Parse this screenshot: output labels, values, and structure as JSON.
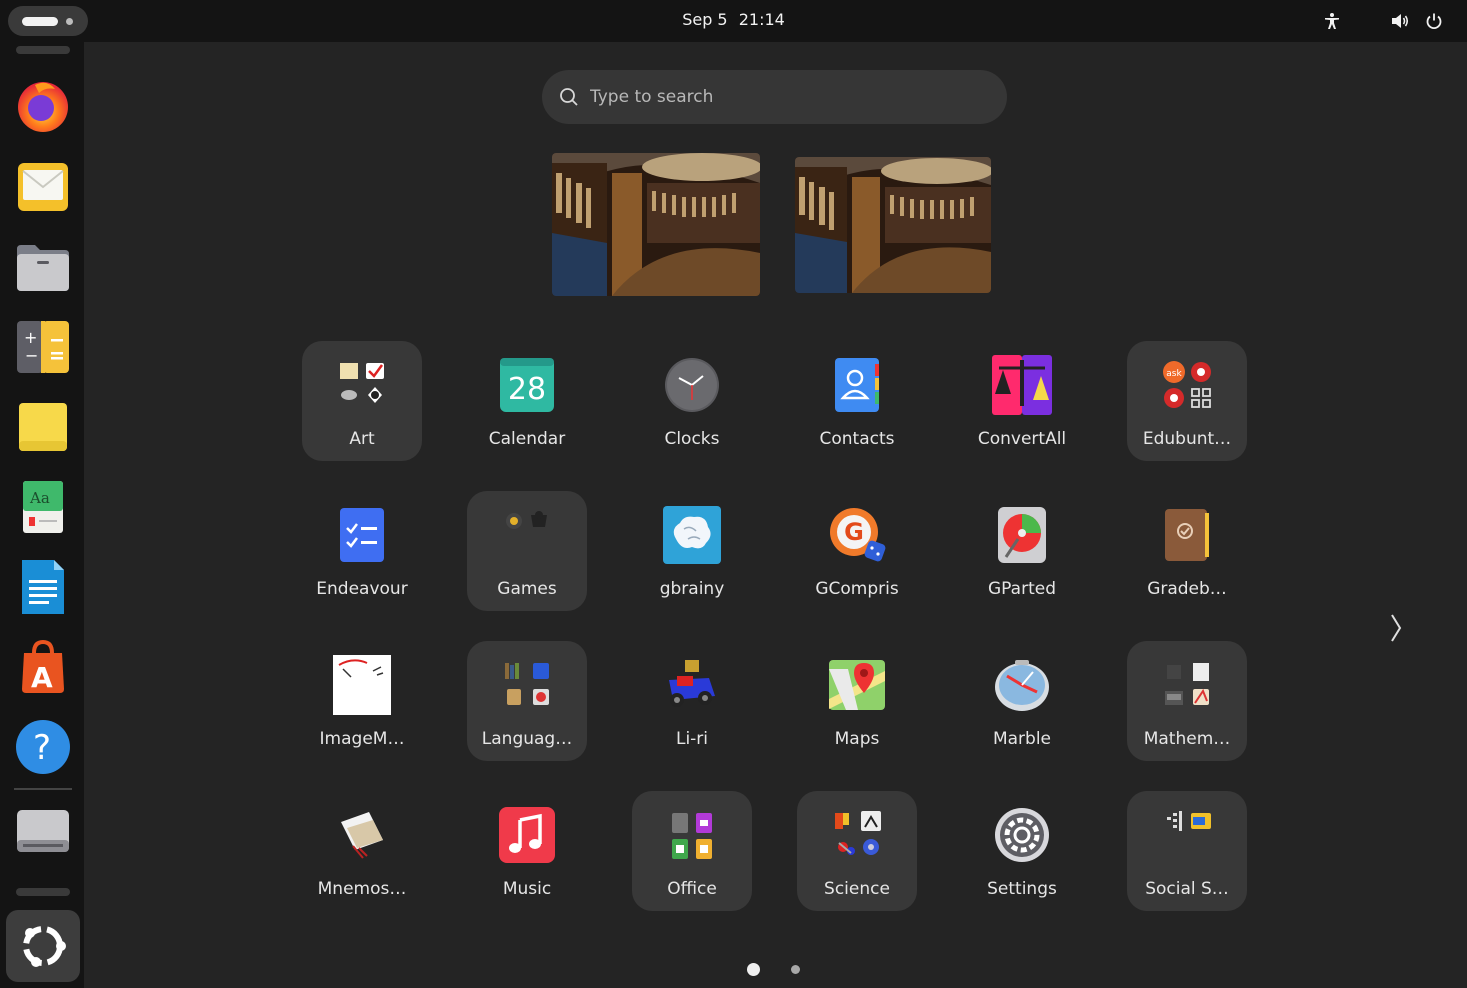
{
  "topbar": {
    "date": "Sep 5",
    "time": "21:14",
    "icons": [
      "activities-indicator",
      "accessibility-icon",
      "volume-icon",
      "power-icon"
    ]
  },
  "dock": {
    "items": [
      {
        "name": "Firefox",
        "icon": "firefox-icon"
      },
      {
        "name": "Thunderbird Mail",
        "icon": "mail-icon"
      },
      {
        "name": "Files",
        "icon": "files-icon"
      },
      {
        "name": "Calculator",
        "icon": "calculator-icon"
      },
      {
        "name": "Notes",
        "icon": "notes-icon"
      },
      {
        "name": "Dictionary",
        "icon": "dictionary-icon"
      },
      {
        "name": "LibreOffice Writer",
        "icon": "writer-icon"
      },
      {
        "name": "App Center",
        "icon": "app-center-icon"
      },
      {
        "name": "Help",
        "icon": "help-icon"
      },
      {
        "name": "Drive",
        "icon": "drive-icon"
      },
      {
        "name": "Show Apps",
        "icon": "show-apps-icon"
      }
    ]
  },
  "search": {
    "placeholder": "Type to search"
  },
  "workspaces": [
    {
      "name": "workspace-1",
      "thumbnail": "library-wallpaper"
    },
    {
      "name": "workspace-2",
      "thumbnail": "library-wallpaper"
    }
  ],
  "apps": [
    {
      "label": "Art",
      "folder": true,
      "icon": "art-folder-icon"
    },
    {
      "label": "Calendar",
      "folder": false,
      "icon": "calendar-icon",
      "icon_text": "28"
    },
    {
      "label": "Clocks",
      "folder": false,
      "icon": "clocks-icon"
    },
    {
      "label": "Contacts",
      "folder": false,
      "icon": "contacts-icon"
    },
    {
      "label": "ConvertAll",
      "folder": false,
      "icon": "convertall-icon"
    },
    {
      "label": "Edubunt…",
      "folder": true,
      "icon": "edubuntu-folder-icon"
    },
    {
      "label": "Endeavour",
      "folder": false,
      "icon": "endeavour-icon"
    },
    {
      "label": "Games",
      "folder": true,
      "icon": "games-folder-icon"
    },
    {
      "label": "gbrainy",
      "folder": false,
      "icon": "gbrainy-icon"
    },
    {
      "label": "GCompris",
      "folder": false,
      "icon": "gcompris-icon"
    },
    {
      "label": "GParted",
      "folder": false,
      "icon": "gparted-icon"
    },
    {
      "label": "Gradeb…",
      "folder": false,
      "icon": "gradebook-icon"
    },
    {
      "label": "ImageM…",
      "folder": false,
      "icon": "imagemagick-icon"
    },
    {
      "label": "Languag…",
      "folder": true,
      "icon": "language-folder-icon"
    },
    {
      "label": "Li-ri",
      "folder": false,
      "icon": "liri-icon"
    },
    {
      "label": "Maps",
      "folder": false,
      "icon": "maps-icon"
    },
    {
      "label": "Marble",
      "folder": false,
      "icon": "marble-icon"
    },
    {
      "label": "Mathem…",
      "folder": true,
      "icon": "mathematics-folder-icon"
    },
    {
      "label": "Mnemos…",
      "folder": false,
      "icon": "mnemosyne-icon"
    },
    {
      "label": "Music",
      "folder": false,
      "icon": "music-icon"
    },
    {
      "label": "Office",
      "folder": true,
      "icon": "office-folder-icon"
    },
    {
      "label": "Science",
      "folder": true,
      "icon": "science-folder-icon"
    },
    {
      "label": "Settings",
      "folder": false,
      "icon": "settings-icon"
    },
    {
      "label": "Social S…",
      "folder": true,
      "icon": "social-studies-folder-icon"
    }
  ],
  "pagination": {
    "current_page": 1,
    "total_pages": 2
  },
  "colors": {
    "background": "#242424",
    "topbar": "#141414",
    "dock": "#141414",
    "folder": "#383838",
    "accent": "#e95420"
  }
}
